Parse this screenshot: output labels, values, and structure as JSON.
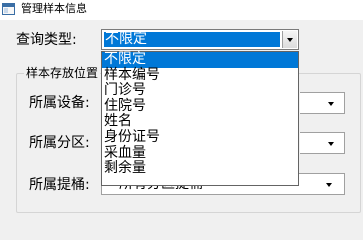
{
  "window": {
    "title": "管理样本信息"
  },
  "query": {
    "label": "查询类型:",
    "selected": "不限定",
    "options": [
      "不限定",
      "样本编号",
      "门诊号",
      "住院号",
      "姓名",
      "身份证号",
      "采血量",
      "剩余量"
    ]
  },
  "storage_group": {
    "title": "样本存放位置",
    "device_label": "所属设备:",
    "zone_label": "所属分区:",
    "bucket_label": "所属提桶:",
    "bucket_value": "所有分区提桶"
  },
  "colors": {
    "selection": "#0078d7",
    "window_bg": "#f0f0f0"
  }
}
